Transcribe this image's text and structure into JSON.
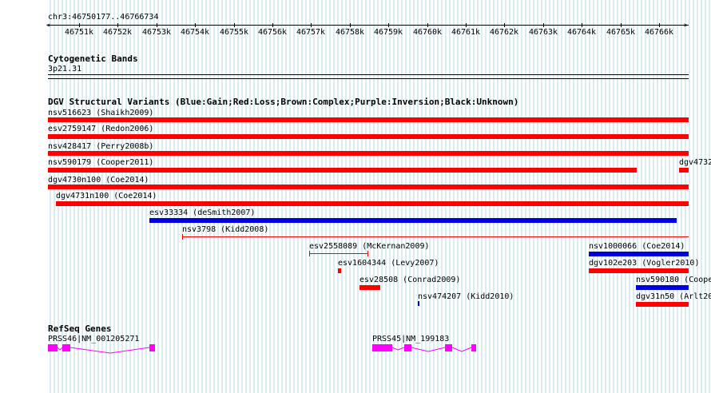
{
  "ruler": {
    "position": "chr3:46750177..46766734",
    "ticks": [
      "46751k",
      "46752k",
      "46753k",
      "46754k",
      "46755k",
      "46756k",
      "46757k",
      "46758k",
      "46759k",
      "46760k",
      "46761k",
      "46762k",
      "46763k",
      "46764k",
      "46765k",
      "46766k"
    ]
  },
  "cytobands": {
    "title": "Cytogenetic Bands",
    "band": "3p21.31"
  },
  "dgv": {
    "title": "DGV Structural Variants (Blue:Gain;Red:Loss;Brown:Complex;Purple:Inversion;Black:Unknown)",
    "colors": {
      "loss": "#ff0000",
      "gain": "#0000dd"
    },
    "variants": [
      {
        "label": "nsv516623 (Shaikh2009)",
        "type": "loss"
      },
      {
        "label": "esv2759147 (Redon2006)",
        "type": "loss"
      },
      {
        "label": "nsv428417 (Perry2008b)",
        "type": "loss"
      },
      {
        "label": "nsv590179 (Cooper2011)",
        "type": "loss"
      },
      {
        "label": "dgv4732",
        "type": "loss"
      },
      {
        "label": "dgv4730n100 (Coe2014)",
        "type": "loss"
      },
      {
        "label": "dgv4731n100 (Coe2014)",
        "type": "loss"
      },
      {
        "label": "esv33334 (deSmith2007)",
        "type": "gain"
      },
      {
        "label": "nsv3798 (Kidd2008)",
        "type": "loss"
      },
      {
        "label": "esv2558089 (McKernan2009)",
        "type": "loss"
      },
      {
        "label": "nsv1000066 (Coe2014)",
        "type": "gain"
      },
      {
        "label": "esv1604344 (Levy2007)",
        "type": "loss"
      },
      {
        "label": "dgv102e203 (Vogler2010)",
        "type": "loss"
      },
      {
        "label": "esv28508 (Conrad2009)",
        "type": "loss"
      },
      {
        "label": "nsv590180 (Coope",
        "type": "gain"
      },
      {
        "label": "nsv474207 (Kidd2010)",
        "type": "gain"
      },
      {
        "label": "dgv31n50 (Arlt20",
        "type": "loss"
      }
    ]
  },
  "refseq": {
    "title": "RefSeq Genes",
    "color": "#ff00ff",
    "genes": [
      {
        "label": "PRSS46|NM_001205271"
      },
      {
        "label": "PRSS45|NM_199183"
      }
    ]
  }
}
